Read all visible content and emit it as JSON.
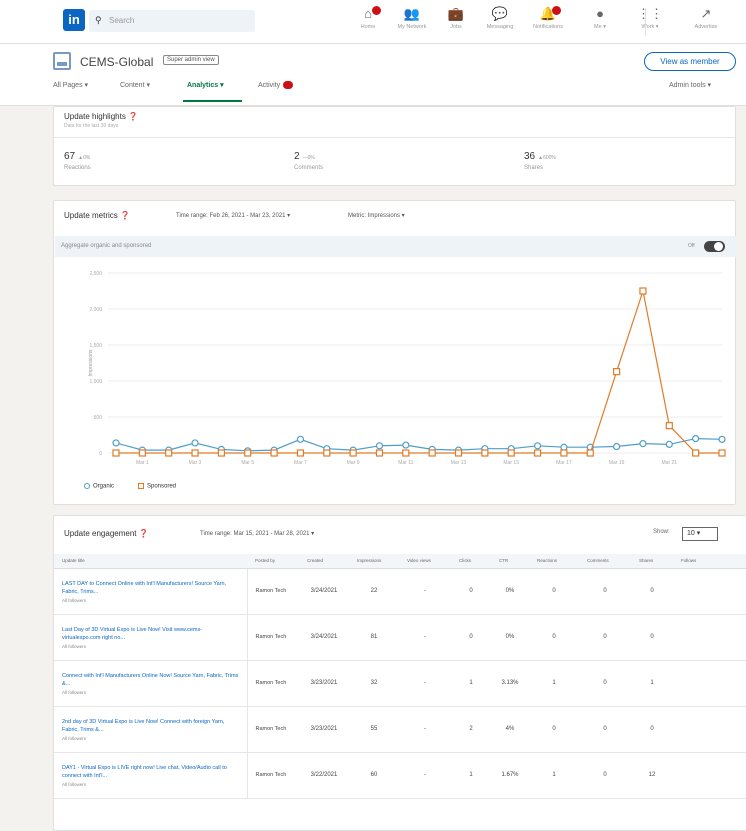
{
  "nav": {
    "logo": "in",
    "search_placeholder": "Search",
    "items": [
      {
        "label": "Home",
        "icon": "home-icon",
        "glyph": "⌂",
        "badge": true
      },
      {
        "label": "My Network",
        "icon": "network-icon",
        "glyph": "👥",
        "badge": false
      },
      {
        "label": "Jobs",
        "icon": "briefcase-icon",
        "glyph": "💼",
        "badge": false
      },
      {
        "label": "Messaging",
        "icon": "message-icon",
        "glyph": "💬",
        "badge": false
      },
      {
        "label": "Notifications",
        "icon": "bell-icon",
        "glyph": "🔔",
        "badge": true
      },
      {
        "label": "Me ▾",
        "icon": "avatar-icon",
        "glyph": "●",
        "badge": false
      },
      {
        "label": "Work ▾",
        "icon": "grid-icon",
        "glyph": "⋮⋮",
        "badge": false
      },
      {
        "label": "Advertise",
        "icon": "external-icon",
        "glyph": "↗",
        "badge": false
      }
    ]
  },
  "page": {
    "name": "CEMS-Global",
    "role": "Super admin view",
    "view_as_member": "View as member",
    "tabs": [
      "All Pages ▾",
      "Content ▾",
      "Analytics ▾",
      "Activity"
    ],
    "admin_tools": "Admin tools ▾"
  },
  "highlights": {
    "title": "Update highlights",
    "subtitle": "Data for the last 30 days",
    "stats": [
      {
        "value": "67",
        "delta": "▲0%",
        "label": "Reactions"
      },
      {
        "value": "2",
        "delta": "—0%",
        "label": "Comments"
      },
      {
        "value": "36",
        "delta": "▲600%",
        "label": "Shares"
      }
    ]
  },
  "metrics": {
    "title": "Update metrics",
    "time_range": "Time range: Feb 26, 2021 - Mar 23, 2021 ▾",
    "metric": "Metric: Impressions ▾",
    "aggregate_label": "Aggregate organic and sponsored",
    "toggle_label": "Off"
  },
  "chart_data": {
    "type": "line",
    "ylabel": "Impressions",
    "ylim": [
      0,
      2500
    ],
    "yticks": [
      "0",
      "500",
      "1,000",
      "1,500",
      "2,000",
      "2,500"
    ],
    "xticks": [
      "Mar 1",
      "Mar 3",
      "Mar 5",
      "Mar 7",
      "Mar 9",
      "Mar 11",
      "Mar 13",
      "Mar 15",
      "Mar 17",
      "Mar 19",
      "Mar 21"
    ],
    "series": [
      {
        "name": "Organic",
        "color": "#4f9ec9",
        "values": [
          140,
          40,
          40,
          140,
          50,
          30,
          40,
          190,
          60,
          40,
          100,
          110,
          50,
          40,
          60,
          60,
          100,
          80,
          80,
          90,
          130,
          120,
          200,
          190
        ]
      },
      {
        "name": "Sponsored",
        "color": "#e07b28",
        "values": [
          0,
          0,
          0,
          0,
          0,
          0,
          0,
          0,
          0,
          0,
          0,
          0,
          0,
          0,
          0,
          0,
          0,
          0,
          0,
          1130,
          2250,
          380,
          0,
          0
        ]
      }
    ]
  },
  "engagement": {
    "title": "Update engagement",
    "time_range": "Time range: Mar 15, 2021 - Mar 28, 2021 ▾",
    "show_label": "Show:",
    "show_value": "10 ▾",
    "columns": [
      "Update title",
      "Posted by",
      "Created",
      "Impressions",
      "Video views",
      "Clicks",
      "CTR",
      "Reactions",
      "Comments",
      "Shares",
      "Follows"
    ],
    "rows": [
      {
        "title": "LAST DAY to Connect Online with Int'l Manufacturers! Source Yarn, Fabric, Trims...",
        "audience": "All followers",
        "posted_by": "Ramon Tech",
        "created": "3/24/2021",
        "impressions": "22",
        "video": "-",
        "clicks": "0",
        "ctr": "0%",
        "reactions": "0",
        "comments": "0",
        "shares": "0"
      },
      {
        "title": "Last Day of 3D Virtual Expo is Live Now! Visit www.cems-virtualexpo.com right no...",
        "audience": "All followers",
        "posted_by": "Ramon Tech",
        "created": "3/24/2021",
        "impressions": "81",
        "video": "-",
        "clicks": "0",
        "ctr": "0%",
        "reactions": "0",
        "comments": "0",
        "shares": "0"
      },
      {
        "title": "Connect with Int'l Manufacturers Online Now! Source Yarn, Fabric, Trims &...",
        "audience": "All followers",
        "posted_by": "Ramon Tech",
        "created": "3/23/2021",
        "impressions": "32",
        "video": "-",
        "clicks": "1",
        "ctr": "3.13%",
        "reactions": "1",
        "comments": "0",
        "shares": "1"
      },
      {
        "title": "2nd day of 3D Virtual Expo is Live Now! Connect with foreign Yarn, Fabric, Trims &...",
        "audience": "All followers",
        "posted_by": "Ramon Tech",
        "created": "3/23/2021",
        "impressions": "55",
        "video": "-",
        "clicks": "2",
        "ctr": "4%",
        "reactions": "0",
        "comments": "0",
        "shares": "0"
      },
      {
        "title": "DAY1 - Virtual Expo is LIVE right now! Live chat, Video/Audio call to connect with Int'l...",
        "audience": "All followers",
        "posted_by": "Ramon Tech",
        "created": "3/22/2021",
        "impressions": "60",
        "video": "-",
        "clicks": "1",
        "ctr": "1.67%",
        "reactions": "1",
        "comments": "0",
        "shares": "12"
      }
    ]
  }
}
